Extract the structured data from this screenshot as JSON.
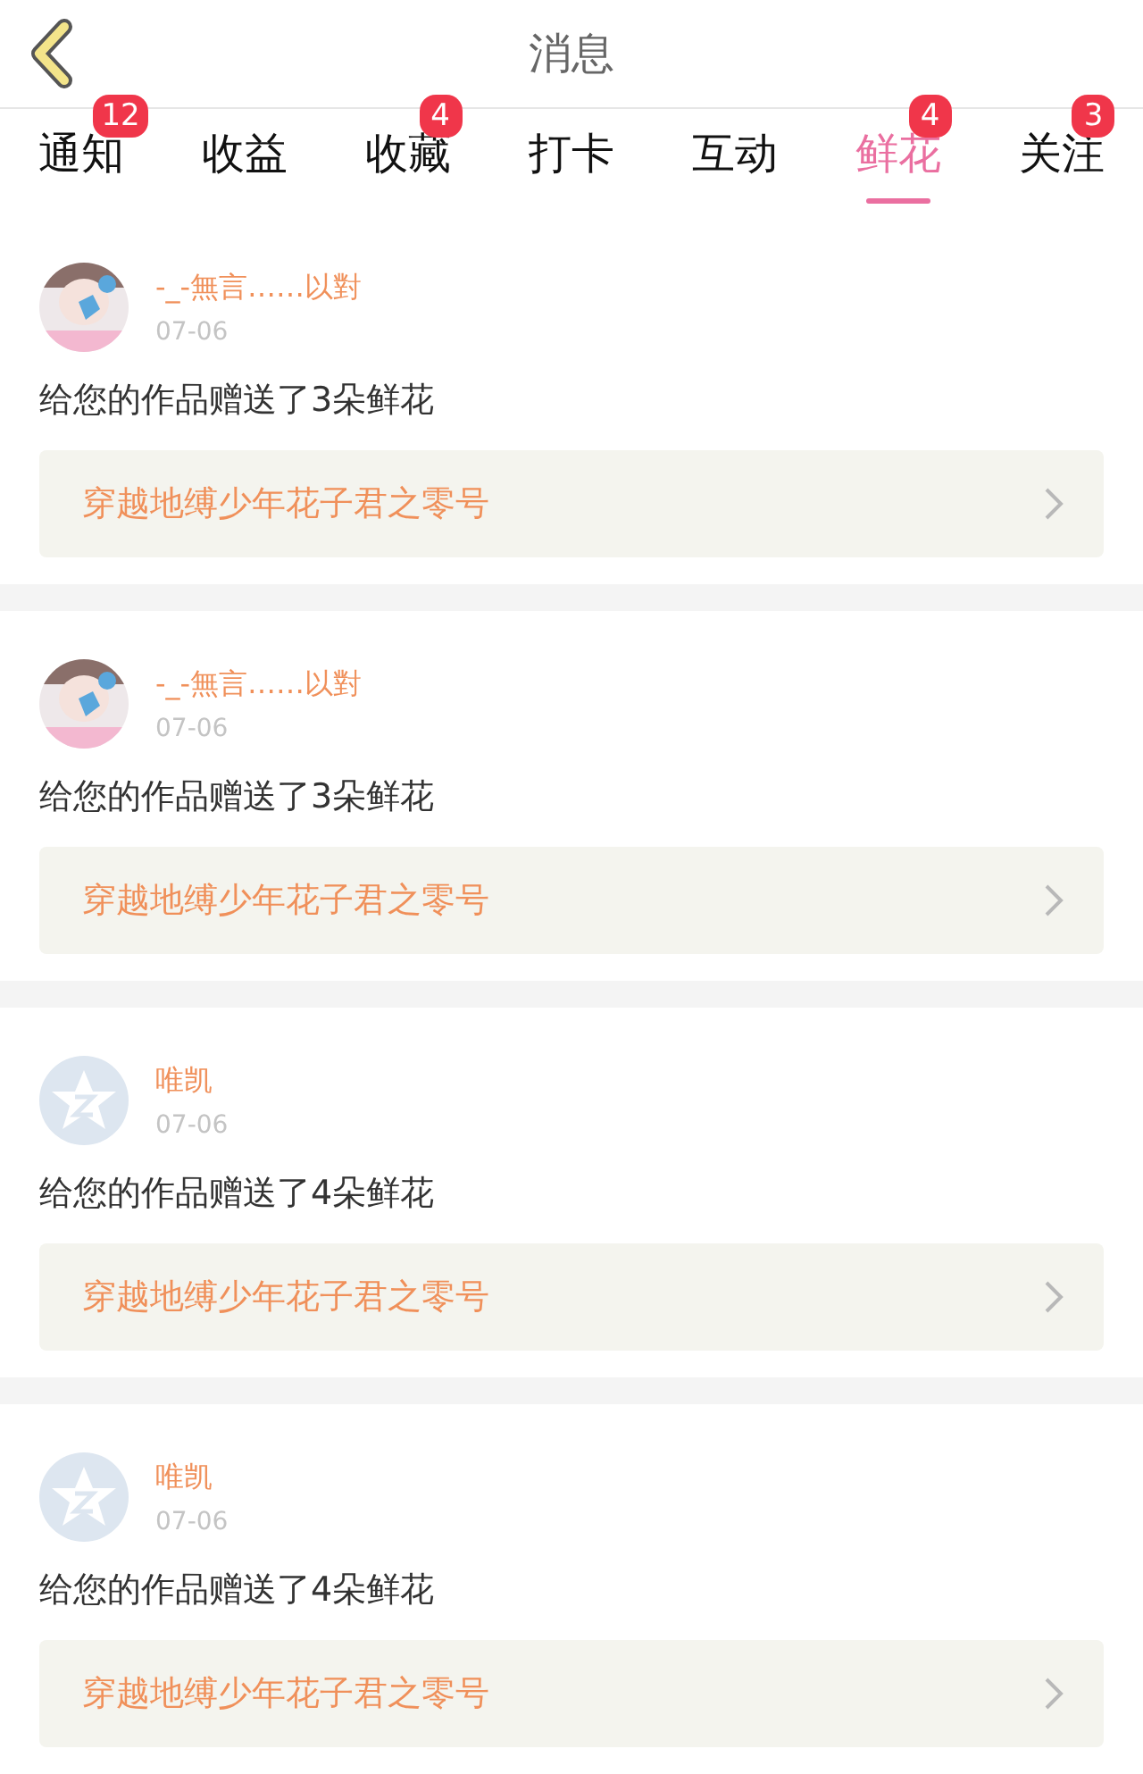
{
  "header": {
    "title": "消息"
  },
  "tabs": [
    {
      "label": "通知",
      "badge": "12",
      "selected": false
    },
    {
      "label": "收益",
      "selected": false
    },
    {
      "label": "收藏",
      "badge": "4",
      "selected": false
    },
    {
      "label": "打卡",
      "selected": false
    },
    {
      "label": "互动",
      "selected": false
    },
    {
      "label": "鲜花",
      "badge": "4",
      "selected": true
    },
    {
      "label": "关注",
      "badge": "3",
      "selected": false
    }
  ],
  "messages": [
    {
      "user": "-_-無言……以對",
      "date": "07-06",
      "text": "给您的作品赠送了3朵鲜花",
      "work": "穿越地缚少年花子君之零号"
    },
    {
      "user": "-_-無言……以對",
      "date": "07-06",
      "text": "给您的作品赠送了3朵鲜花",
      "work": "穿越地缚少年花子君之零号"
    },
    {
      "kind": "default",
      "user": "唯凯",
      "date": "07-06",
      "text": "给您的作品赠送了4朵鲜花",
      "work": "穿越地缚少年花子君之零号"
    },
    {
      "kind": "default",
      "user": "唯凯",
      "date": "07-06",
      "text": "给您的作品赠送了4朵鲜花",
      "work": "穿越地缚少年花子君之零号"
    }
  ]
}
